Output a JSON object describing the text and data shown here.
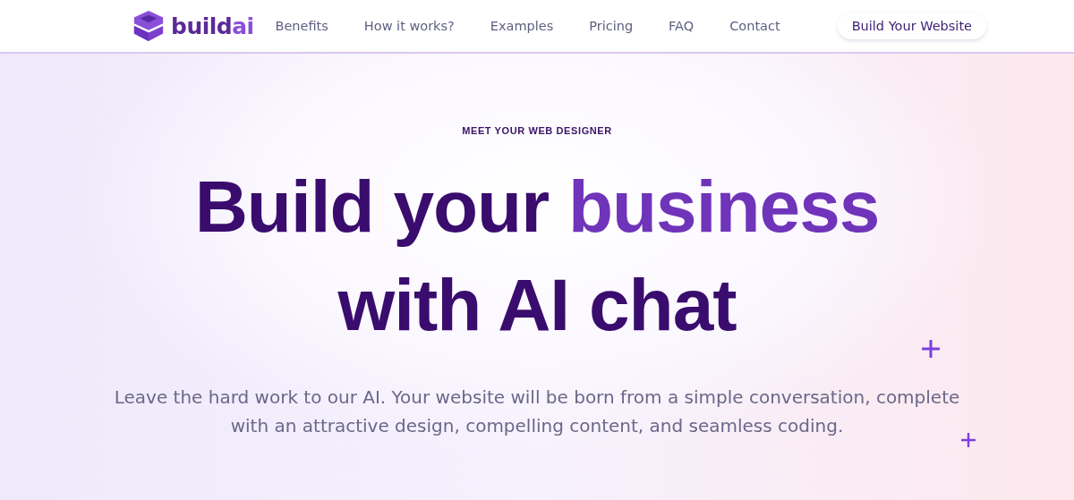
{
  "logo": {
    "parts": [
      {
        "text": "build",
        "kind": "base"
      },
      {
        "text": "ai",
        "kind": "accent"
      }
    ]
  },
  "nav": {
    "links": [
      "Benefits",
      "How it works?",
      "Examples",
      "Pricing",
      "FAQ",
      "Contact"
    ],
    "cta": "Build Your Website"
  },
  "hero": {
    "eyebrow": "MEET YOUR WEB DESIGNER",
    "headline": [
      [
        {
          "text": "Build your ",
          "kind": "base"
        },
        {
          "text": "business",
          "kind": "accent"
        }
      ],
      [
        {
          "text": "with AI chat",
          "kind": "base"
        }
      ]
    ],
    "subtitle": "Leave the hard work to our AI. Your website will be born from a simple conversation, complete with an attractive design, compelling content, and seamless coding."
  }
}
